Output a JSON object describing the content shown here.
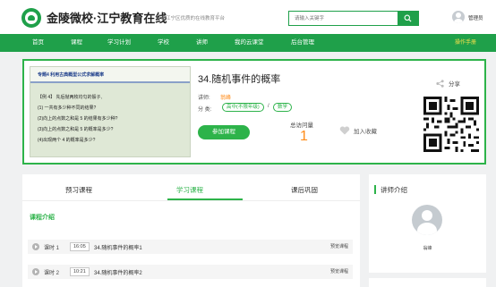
{
  "header": {
    "site_name": "金陵微校·江宁教育在线",
    "tagline": "打造江宁区优质的在线教育平台",
    "search_placeholder": "请输入关键字",
    "user_name": "管理员",
    "brand_color": "#1fa04a"
  },
  "nav": {
    "items": [
      "首页",
      "课程",
      "学习计划",
      "学校",
      "讲师",
      "我的云课堂",
      "后台管理"
    ],
    "manual_label": "操作手册"
  },
  "course": {
    "title": "34.随机事件的概率",
    "lecturer_label": "讲师:",
    "lecturer_name": "翁峰",
    "category_label": "分 类:",
    "categories": [
      "高中(不限年级)",
      "数学"
    ],
    "category_sep": "/",
    "join_label": "参加课程",
    "visits_label": "总访问量",
    "visits_value": "1",
    "favorite_label": "加入收藏",
    "share_label": "分享",
    "thumbnail": {
      "tag": "专题4  利用古典概型公式求解概率",
      "lines": [
        "【例 4】  先后抛两枚均匀的骰子,",
        "(1) 一共有多少种不同的结果?",
        "(2)向上的点数之和是 5 的结果有多少种?",
        "(3)向上的点数之和是 5 的概率是多少?",
        "(4)出现两个 4 的概率是多少?"
      ]
    }
  },
  "tabs": {
    "items": [
      "预习课程",
      "学习课程",
      "课后巩固"
    ],
    "active": "学习课程"
  },
  "intro_heading": "课程介绍",
  "lessons": [
    {
      "number": "课时 1",
      "duration": "16:05",
      "title": "34.随机事件的概率1",
      "action": "预览课程"
    },
    {
      "number": "课时 2",
      "duration": "10:21",
      "title": "34.随机事件的概率2",
      "action": "预览课程"
    }
  ],
  "lecturer_panel": {
    "title": "讲师介绍",
    "name": "翁峰"
  }
}
